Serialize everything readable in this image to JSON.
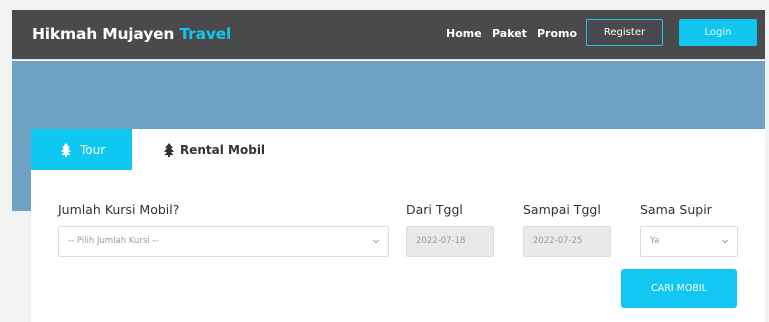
{
  "header": {
    "brand_main": "Hikmah Mujayen",
    "brand_accent": "Travel",
    "nav": [
      "Home",
      "Paket",
      "Promo"
    ],
    "register_label": "Register",
    "login_label": "Login"
  },
  "tabs": [
    {
      "label": "Tour",
      "icon": "tree-icon",
      "active": true
    },
    {
      "label": "Rental Mobil",
      "icon": "tree-icon",
      "active": false
    }
  ],
  "form": {
    "kursi_label": "Jumlah Kursi Mobil?",
    "kursi_value": "-- Pilih Jumlah Kursi --",
    "dari_label": "Dari Tggl",
    "dari_value": "2022-07-18",
    "sampai_label": "Sampai Tggl",
    "sampai_value": "2022-07-25",
    "supir_label": "Sama Supir",
    "supir_value": "Ya",
    "submit_label": "CARI MOBIL"
  },
  "colors": {
    "accent": "#10c6f0",
    "header_bg": "#4a4a4c",
    "hero_bg": "#6fa2c4"
  }
}
